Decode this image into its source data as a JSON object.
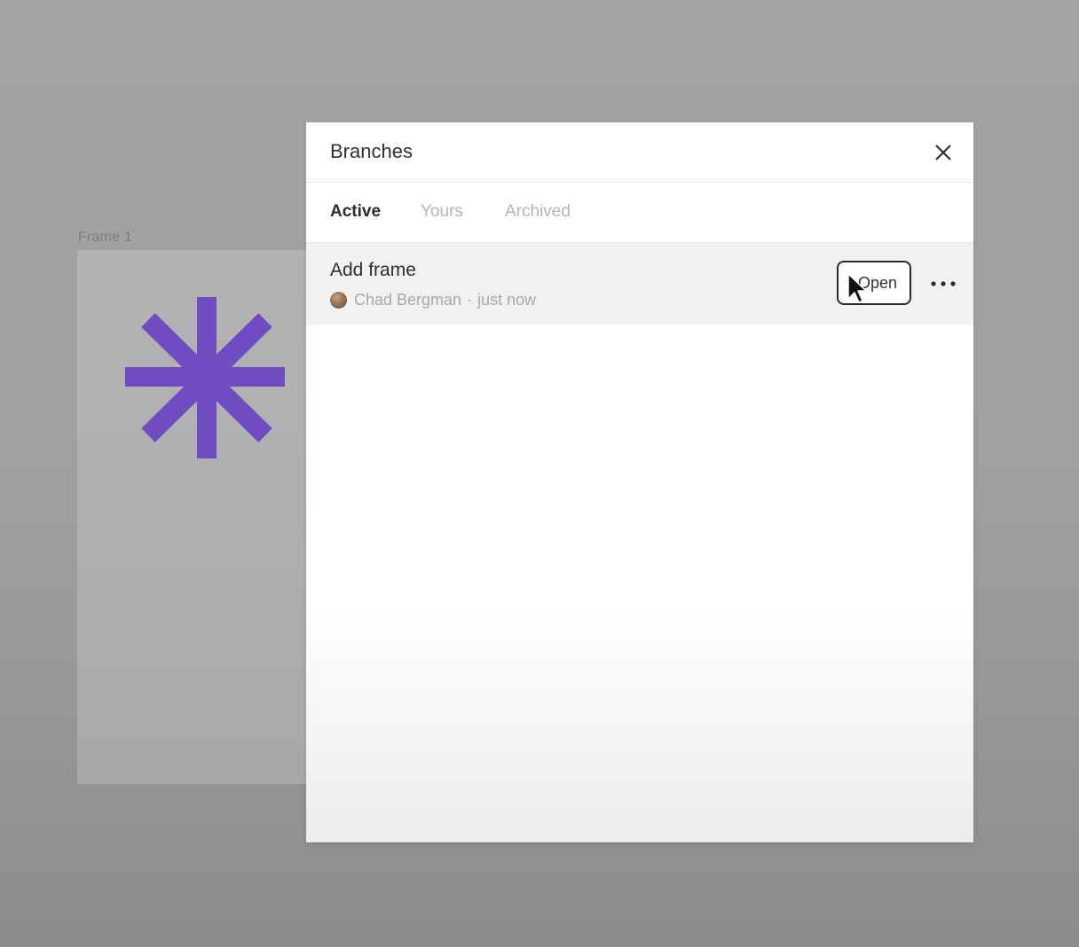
{
  "canvas": {
    "frame_label": "Frame 1",
    "asterisk_color": "#6f4cc2"
  },
  "panel": {
    "title": "Branches",
    "close_icon": "close-icon",
    "tabs": [
      {
        "label": "Active",
        "active": true
      },
      {
        "label": "Yours",
        "active": false
      },
      {
        "label": "Archived",
        "active": false
      }
    ],
    "branches": [
      {
        "name": "Add frame",
        "author": "Chad Bergman",
        "separator": "·",
        "time": "just now",
        "open_label": "Open",
        "more_icon": "more-horizontal-icon"
      }
    ]
  }
}
